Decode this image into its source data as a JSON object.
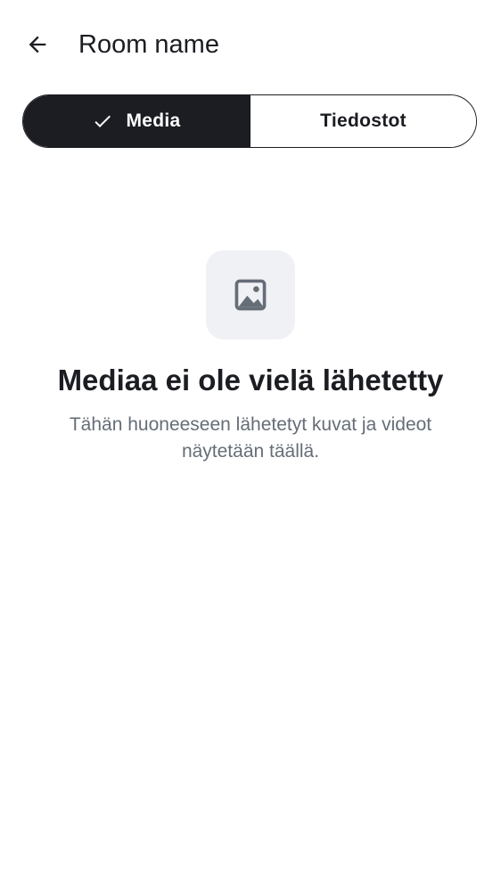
{
  "header": {
    "back_icon": "arrow-left-icon",
    "title": "Room name"
  },
  "tabs": [
    {
      "label": "Media",
      "selected": true,
      "icon": "check-icon"
    },
    {
      "label": "Tiedostot",
      "selected": false
    }
  ],
  "empty_state": {
    "icon": "image-icon",
    "title": "Mediaa ei ole vielä lähetetty",
    "description": "Tähän huoneeseen lähetetyt kuvat ja videot näytetään täällä."
  },
  "colors": {
    "primary": "#1b1d22",
    "background": "#ffffff",
    "icon_box_background": "#eff1f5",
    "secondary_text": "#656d77"
  }
}
